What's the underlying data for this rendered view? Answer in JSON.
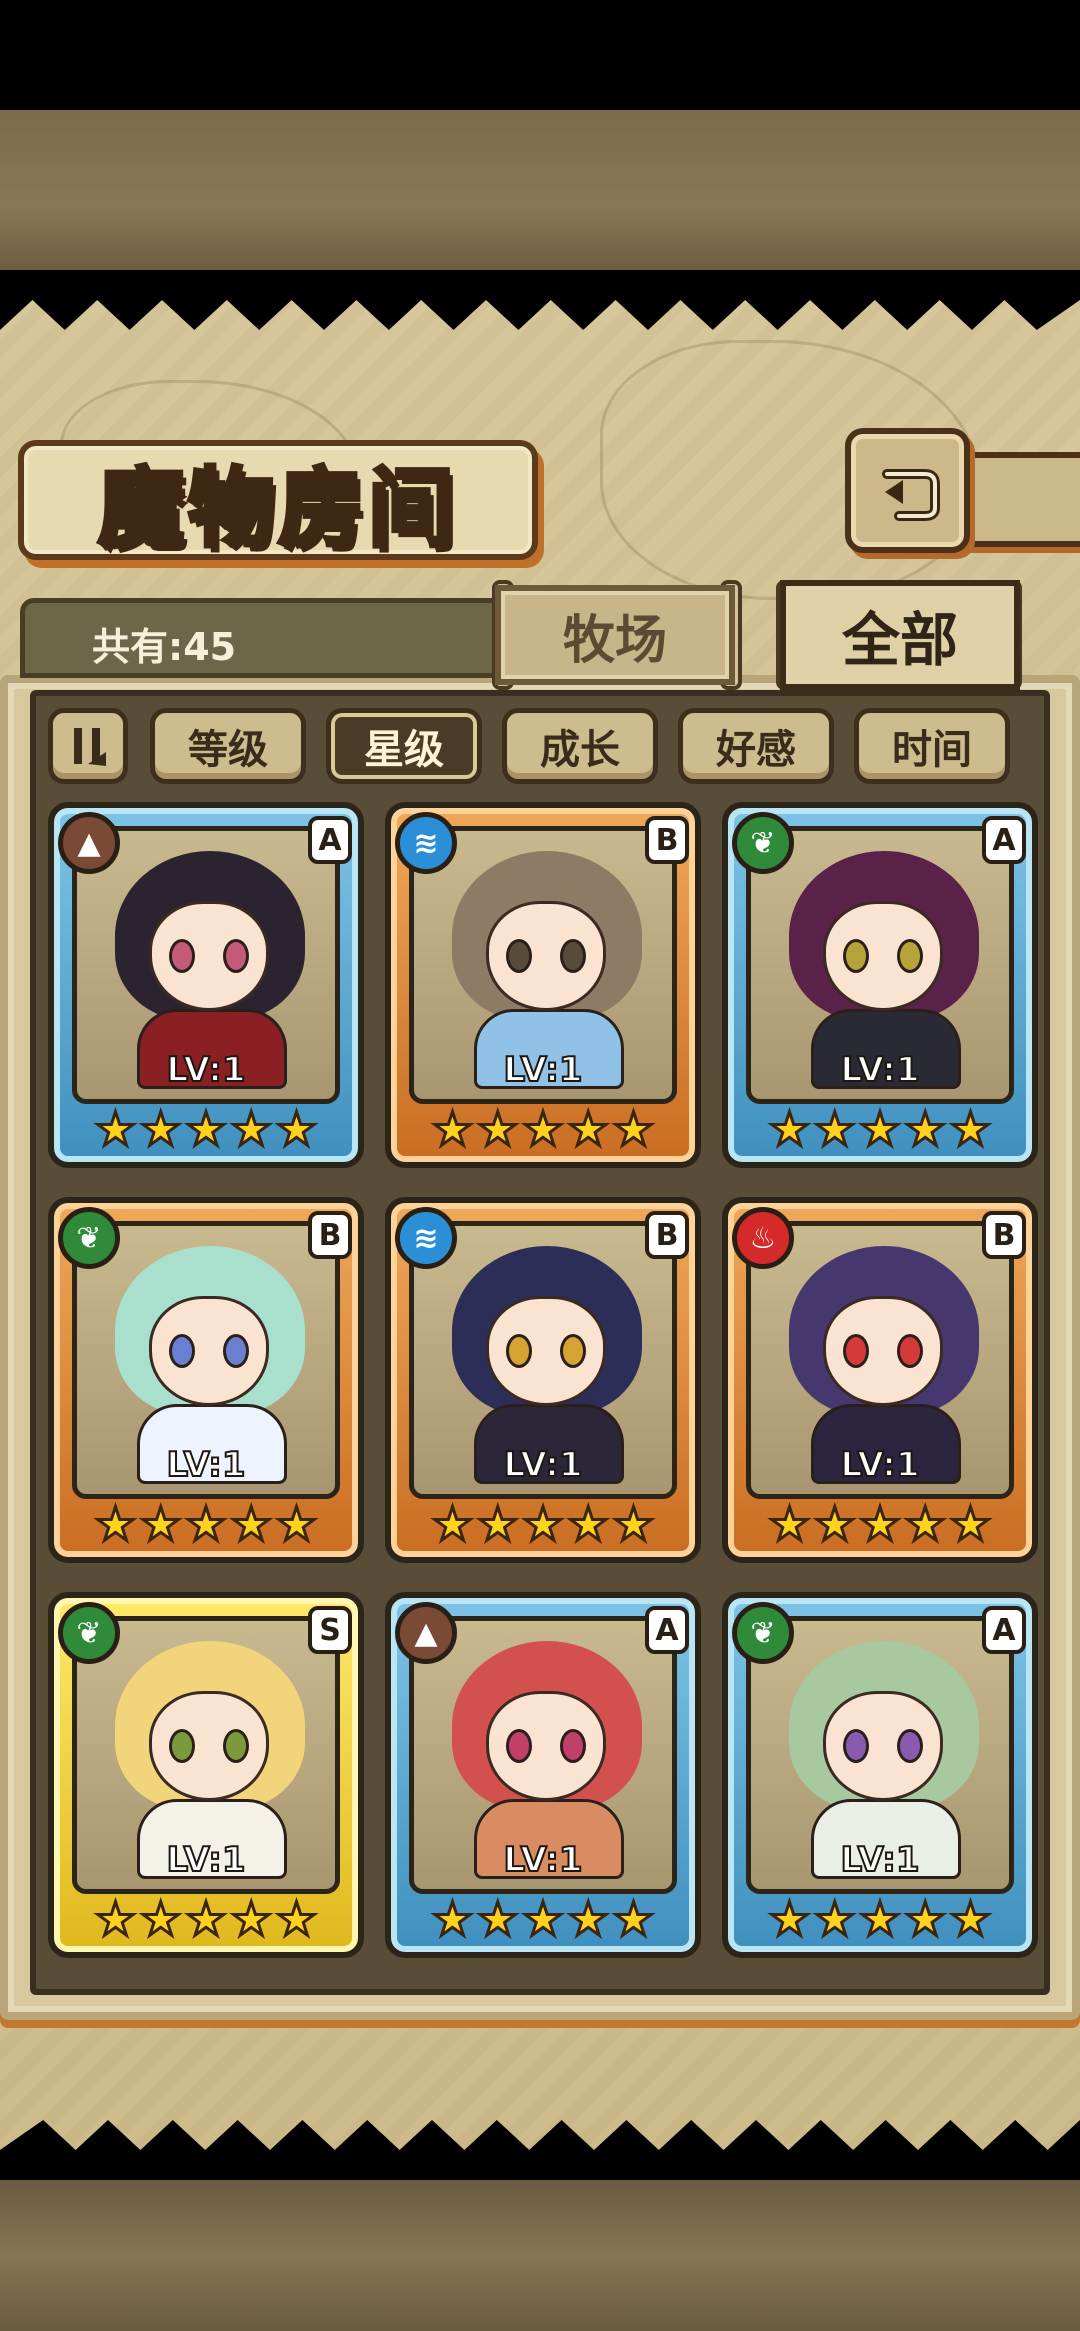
{
  "header": {
    "title": "魔物房间"
  },
  "summary": {
    "count_label": "共有:45"
  },
  "tabs": [
    {
      "label": "牧场"
    },
    {
      "label": "全部"
    }
  ],
  "sort": {
    "buttons": [
      {
        "label": "等级"
      },
      {
        "label": "星级"
      },
      {
        "label": "成长"
      },
      {
        "label": "好感"
      },
      {
        "label": "时间"
      }
    ]
  },
  "monsters": [
    {
      "rank": "A",
      "element": "earth",
      "level": "LV:1",
      "stars": 5,
      "hair": "#2b2430",
      "outfit": "#8a1f24",
      "eye": "#c45a7a"
    },
    {
      "rank": "B",
      "element": "water",
      "level": "LV:1",
      "stars": 5,
      "hair": "#8f7a66",
      "outfit": "#8fc2e6",
      "eye": "#5a4a3a"
    },
    {
      "rank": "A",
      "element": "nature",
      "level": "LV:1",
      "stars": 5,
      "hair": "#5a2248",
      "outfit": "#2a2a34",
      "eye": "#b8a23a"
    },
    {
      "rank": "B",
      "element": "nature",
      "level": "LV:1",
      "stars": 5,
      "hair": "#a9e0cd",
      "outfit": "#eef4ff",
      "eye": "#6a7fd0"
    },
    {
      "rank": "B",
      "element": "water",
      "level": "LV:1",
      "stars": 5,
      "hair": "#2d2e58",
      "outfit": "#2b2738",
      "eye": "#d6a332"
    },
    {
      "rank": "B",
      "element": "fire",
      "level": "LV:1",
      "stars": 5,
      "hair": "#46376f",
      "outfit": "#2c2540",
      "eye": "#d43a3a"
    },
    {
      "rank": "S",
      "element": "nature",
      "level": "LV:1",
      "stars": 5,
      "hair": "#f2d57a",
      "outfit": "#f4f1e8",
      "eye": "#7c9a3a"
    },
    {
      "rank": "A",
      "element": "earth",
      "level": "LV:1",
      "stars": 5,
      "hair": "#d2504e",
      "outfit": "#d98c62",
      "eye": "#c0406a"
    },
    {
      "rank": "A",
      "element": "nature",
      "level": "LV:1",
      "stars": 5,
      "hair": "#a8c9a0",
      "outfit": "#e9efe6",
      "eye": "#8a5ab0"
    }
  ],
  "element_colors": {
    "earth": "#7a4a36",
    "water": "#2a8fd6",
    "nature": "#2f8a3a",
    "fire": "#d42a2a"
  },
  "element_glyphs": {
    "earth": "▲",
    "water": "≋",
    "nature": "❦",
    "fire": "♨"
  }
}
